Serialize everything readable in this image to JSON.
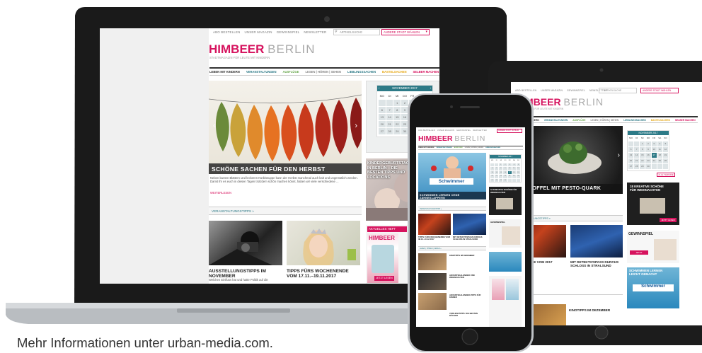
{
  "footer_text": "Mehr Informationen unter urban-media.com.",
  "site": {
    "top_nav": [
      "ABO BESTELLEN",
      "UNSER MAGAZIN",
      "GEWINNSPIEL",
      "NEWSLETTER"
    ],
    "search_placeholder": "ARTIKELSUCHE",
    "city_button": "ANDERE STADT WÄHLEN",
    "logo_bold": "HIMBEER",
    "logo_city": "BERLIN",
    "tagline": "STADTMAGAZIN FÜR LEUTE MIT KINDERN",
    "menu": [
      "LEBEN MIT KINDERN",
      "VERANSTALTUNGEN",
      "AUSFLÜGE",
      "LESEN | HÖREN | SEHEN",
      "LIEBLINGSSACHEN",
      "BASTELSACHEN",
      "SELBER MACHEN"
    ],
    "menu_colors": [
      "#333333",
      "#2d7a87",
      "#6aa84f",
      "#888888",
      "#2d7a87",
      "#e6a817",
      "#d6135e"
    ]
  },
  "laptop": {
    "hero_caption": "SCHÖNE SACHEN FÜR DEN HERBST",
    "hero_text": "Neben bunten Blättern und leckeren Kürbissuppe kann der Herbst manchmal auch kalt und ungemütlich werden. Damit Ihr es euch in diesen Tagen trotzdem schön machen könnt, haben wir viele verschiedene ...",
    "read_more": "WEITERLESEN",
    "section_header": "VERANSTALTUNGSTIPPS »",
    "card1_title": "AUSSTELLUNGSTIPPS IM NOVEMBER",
    "card1_text": "Welchen Einfluss hat und hatte Politik auf die",
    "card2_title": "TIPPS FÜRS WOCHENENDE VOM 17.11.–19.11.2017",
    "calendar_month": "NOVEMBER 2017",
    "calendar_days": [
      "MO",
      "DI",
      "MI",
      "DO",
      "FR",
      "SA",
      "SO"
    ],
    "calendar_dates": [
      "",
      "",
      "1",
      "2",
      "3",
      "4",
      "5",
      "6",
      "7",
      "8",
      "9",
      "10",
      "11",
      "12",
      "13",
      "14",
      "15",
      "16",
      "17",
      "18",
      "19",
      "20",
      "21",
      "22",
      "23",
      "24",
      "25",
      "26",
      "27",
      "28",
      "29",
      "30",
      "",
      "",
      ""
    ],
    "today": "17",
    "side_title": "KINDERGEBURTSTAG IN BERLIN – DIE BESTEN TIPPS UND LOCATIONS",
    "issue_label": "AKTUELLES HEFT",
    "mag_logo": "HIMBEER",
    "issue_button": "JETZT LESEN"
  },
  "tablet": {
    "hero_caption": "KARTOFFEL MIT PESTO-QUARK",
    "calendar_month": "NOVEMBER 2017",
    "calendar_button": "ALLE TERMINE",
    "promo_title": "18 KREATIVE SCHÖNE FÜR WEIHNACHTEN",
    "promo_button": "JETZT LESEN",
    "contest_title": "GEWINNSPIEL",
    "contest_button": "JETZT TEILNEHMEN",
    "card1_title": "ANGEHENDE VOM 2017",
    "card2_title": "MIT DETEKTIVSPASS DURCHS SCHLOSS IN STRALSUND",
    "swim_title": "SCHWIMMEN LERNEN LEICHT GEMACHT",
    "bottom_title": "KINOTIPPS IM DEZEMBER",
    "section_header": "VERANSTALTUNGSTIPPS »"
  },
  "phone": {
    "hero_sign": "Schwimmer",
    "hero_caption": "SCHWIMMEN LERNEN OHNE ZÄHNEKLAPPERN",
    "section1": "VERANSTALTUNGSTIPPS »",
    "card1": "TIPPS FÜRS WOCHENENDE VOM 08.12.-10.12.2017",
    "card2": "MIT DETEKTIVSPASS DURCHS SCHLOSS IN STRALSUND",
    "card3": "GEWINNSPIEL",
    "section2": "LESEN | HÖREN | SEHEN »",
    "list1": "KINOTIPPS IM DEZEMBER",
    "list2": "ADVENTSKALENDER UND WEIHNACHTEN",
    "list3": "ADVENTSKALENDER-TIPPS FÜR KINDER",
    "list4": "VORLESETIPPS: DIE BESTEN BÜCHER",
    "side_promo": "18 KREATIVE SCHÖNE FÜR WEIHNACHTEN"
  }
}
